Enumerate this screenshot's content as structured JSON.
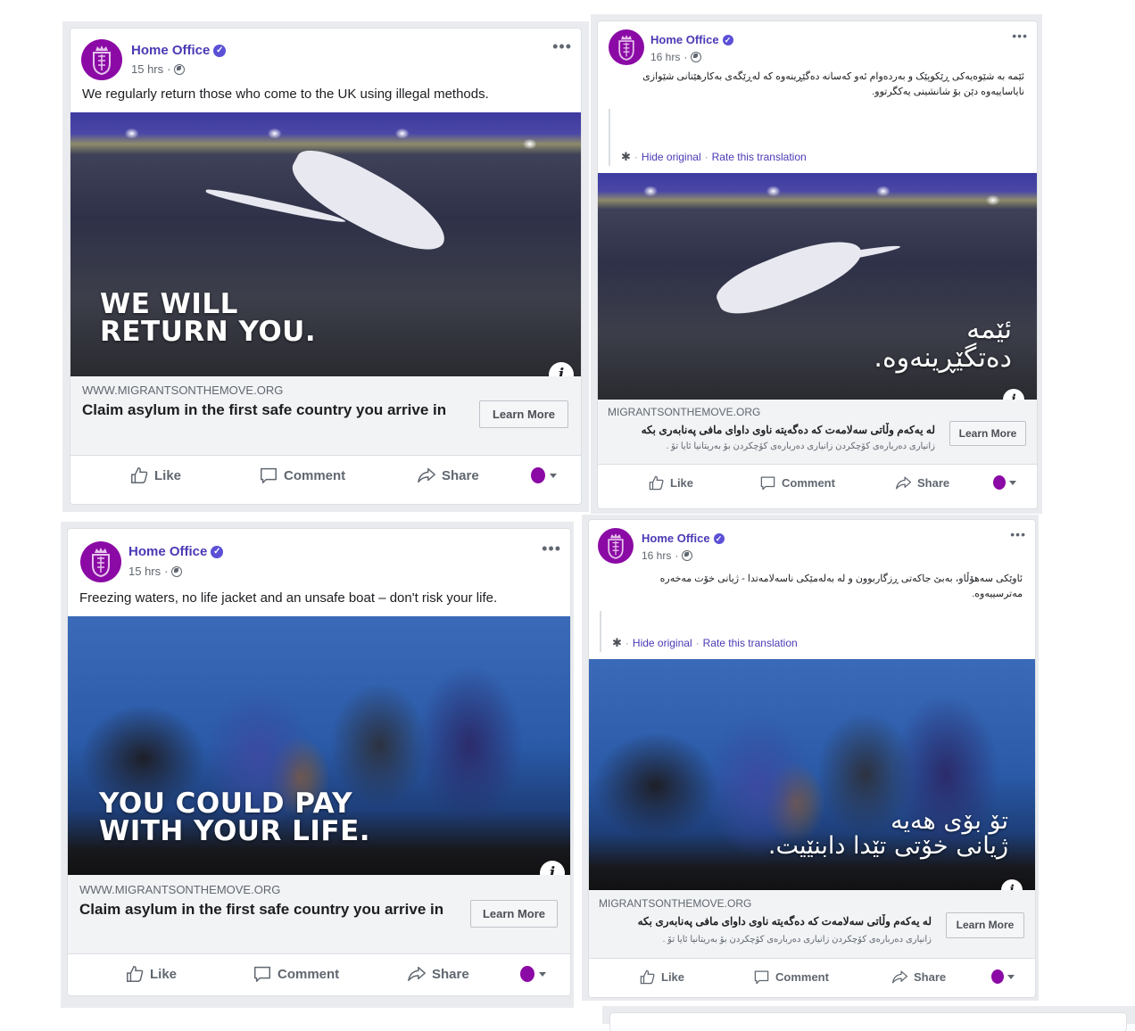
{
  "posts": [
    {
      "page_name": "Home Office",
      "time": "15 hrs",
      "text": "We regularly return those who come to the UK using illegal methods.",
      "overlay": [
        "WE WILL",
        "RETURN YOU."
      ],
      "link_url": "WWW.MIGRANTSONTHEMOVE.ORG",
      "link_headline": "Claim asylum in the first safe country you arrive in",
      "cta": "Learn More",
      "actions": {
        "like": "Like",
        "comment": "Comment",
        "share": "Share"
      }
    },
    {
      "page_name": "Home Office",
      "time": "16 hrs",
      "text": "ئێمە بە شێوەیەکی ڕێکوپێک و بەردەوام ئەو کەسانە دەگێڕینەوە کە لەڕێگەی بەکارهێنانی شێوازی نایاساییەوە دێن بۆ شانشینی یەکگرتوو.",
      "translation_links": {
        "hide": "Hide original",
        "rate": "Rate this translation"
      },
      "overlay": [
        "ئێمە",
        "دەتگێڕینەوە."
      ],
      "link_url": "MIGRANTSONTHEMOVE.ORG",
      "link_headline": "لە یەکەم وڵاتی سەلامەت کە دەگەیتە ناوی داوای مافی پەنابەری بکە",
      "link_description": "زانیاری دەربارەی کۆچکردن زانیاری دەربارەی کۆچکردن بۆ بەریتانیا ئایا تۆ .",
      "cta": "Learn More",
      "actions": {
        "like": "Like",
        "comment": "Comment",
        "share": "Share"
      }
    },
    {
      "page_name": "Home Office",
      "time": "15 hrs",
      "text": "Freezing waters, no life jacket and an unsafe boat – don't risk your life.",
      "overlay": [
        "YOU COULD PAY",
        "WITH YOUR LIFE."
      ],
      "link_url": "WWW.MIGRANTSONTHEMOVE.ORG",
      "link_headline": "Claim asylum in the first safe country you arrive in",
      "cta": "Learn More",
      "actions": {
        "like": "Like",
        "comment": "Comment",
        "share": "Share"
      }
    },
    {
      "page_name": "Home Office",
      "time": "16 hrs",
      "text": "ئاوێکی سەهۆڵاو، بەبێ جاکەتی ڕزگاربوون و لە بەلەمێکی ناسەلامەتدا - ژیانی خۆت مەخەرە مەترسییەوە.",
      "translation_links": {
        "hide": "Hide original",
        "rate": "Rate this translation"
      },
      "overlay": [
        "تۆ بۆی هەیە",
        "ژیانی خۆتی تێدا دابنێیت."
      ],
      "link_url": "MIGRANTSONTHEMOVE.ORG",
      "link_headline": "لە یەکەم وڵاتی سەلامەت کە دەگەیتە ناوی داوای مافی پەنابەری بکە",
      "link_description": "زانیاری دەربارەی کۆچکردن زانیاری دەربارەی کۆچکردن بۆ بەریتانیا ئایا تۆ .",
      "cta": "Learn More",
      "actions": {
        "like": "Like",
        "comment": "Comment",
        "share": "Share"
      }
    }
  ],
  "colors": {
    "page_name": "#4a3ab5",
    "avatar": "#8b0aa5",
    "verified": "#5b50d6",
    "feed_bg": "#e9ebee"
  }
}
